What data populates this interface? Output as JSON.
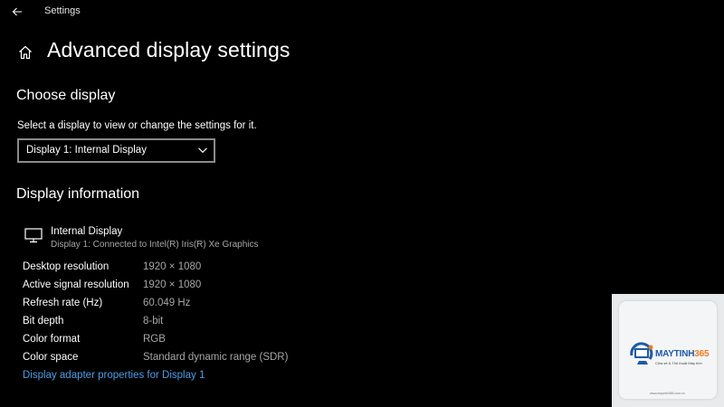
{
  "titlebar": {
    "app_title": "Settings",
    "back_icon": "back-arrow-icon"
  },
  "header": {
    "home_icon": "home-icon",
    "page_title": "Advanced display settings"
  },
  "choose_display": {
    "heading": "Choose display",
    "prompt": "Select a display to view or change the settings for it.",
    "dropdown": {
      "selected": "Display 1: Internal Display",
      "chevron_icon": "chevron-down-icon"
    }
  },
  "display_info": {
    "heading": "Display information",
    "monitor_icon": "monitor-icon",
    "name": "Internal Display",
    "subtitle": "Display 1: Connected to Intel(R) Iris(R) Xe Graphics",
    "rows": [
      {
        "label": "Desktop resolution",
        "value": "1920 × 1080"
      },
      {
        "label": "Active signal resolution",
        "value": "1920 × 1080"
      },
      {
        "label": "Refresh rate (Hz)",
        "value": "60.049 Hz"
      },
      {
        "label": "Bit depth",
        "value": "8-bit"
      },
      {
        "label": "Color format",
        "value": "RGB"
      },
      {
        "label": "Color space",
        "value": "Standard dynamic range (SDR)"
      }
    ],
    "adapter_link": "Display adapter properties for Display 1"
  },
  "watermark": {
    "brand_main": "MAYTINH",
    "brand_accent": "365",
    "tagline": "Chia sẻ & Thủ thuật Máy tính",
    "url": "www.maytinh365.com.vn"
  },
  "colors": {
    "background": "#000000",
    "text_primary": "#ffffff",
    "text_secondary": "#a6a6a6",
    "link": "#4c9fe6",
    "dropdown_border": "#8a8a8a",
    "brand_blue": "#1e5aa8",
    "brand_orange": "#f07a22"
  }
}
